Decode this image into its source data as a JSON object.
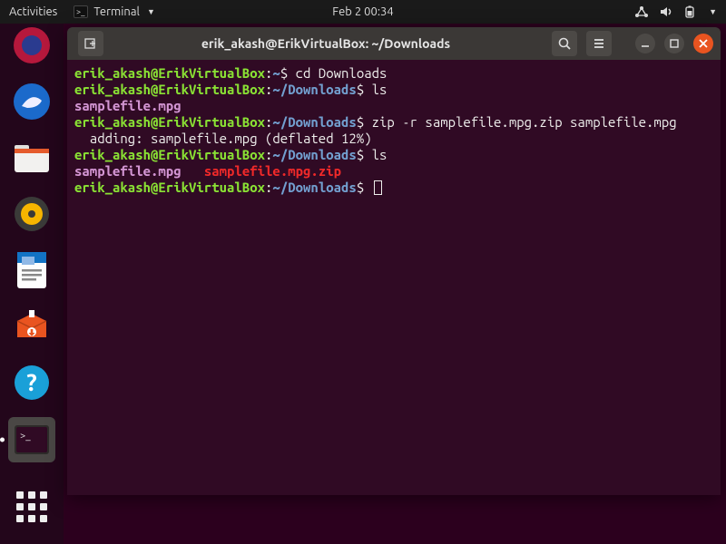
{
  "topbar": {
    "activities": "Activities",
    "app_label": "Terminal",
    "datetime": "Feb 2  00:34"
  },
  "window": {
    "title": "erik_akash@ErikVirtualBox: ~/Downloads"
  },
  "prompt": {
    "userhost": "erik_akash@ErikVirtualBox",
    "home": "~",
    "downloads": "~/Downloads",
    "sep": ":",
    "sigil": "$"
  },
  "cmds": {
    "cd": " cd Downloads",
    "ls": " ls",
    "zip": " zip -r samplefile.mpg.zip samplefile.mpg",
    "zip_out": "  adding: samplefile.mpg (deflated 12%)"
  },
  "files": {
    "mpg": "samplefile.mpg",
    "zip": "samplefile.mpg.zip"
  }
}
